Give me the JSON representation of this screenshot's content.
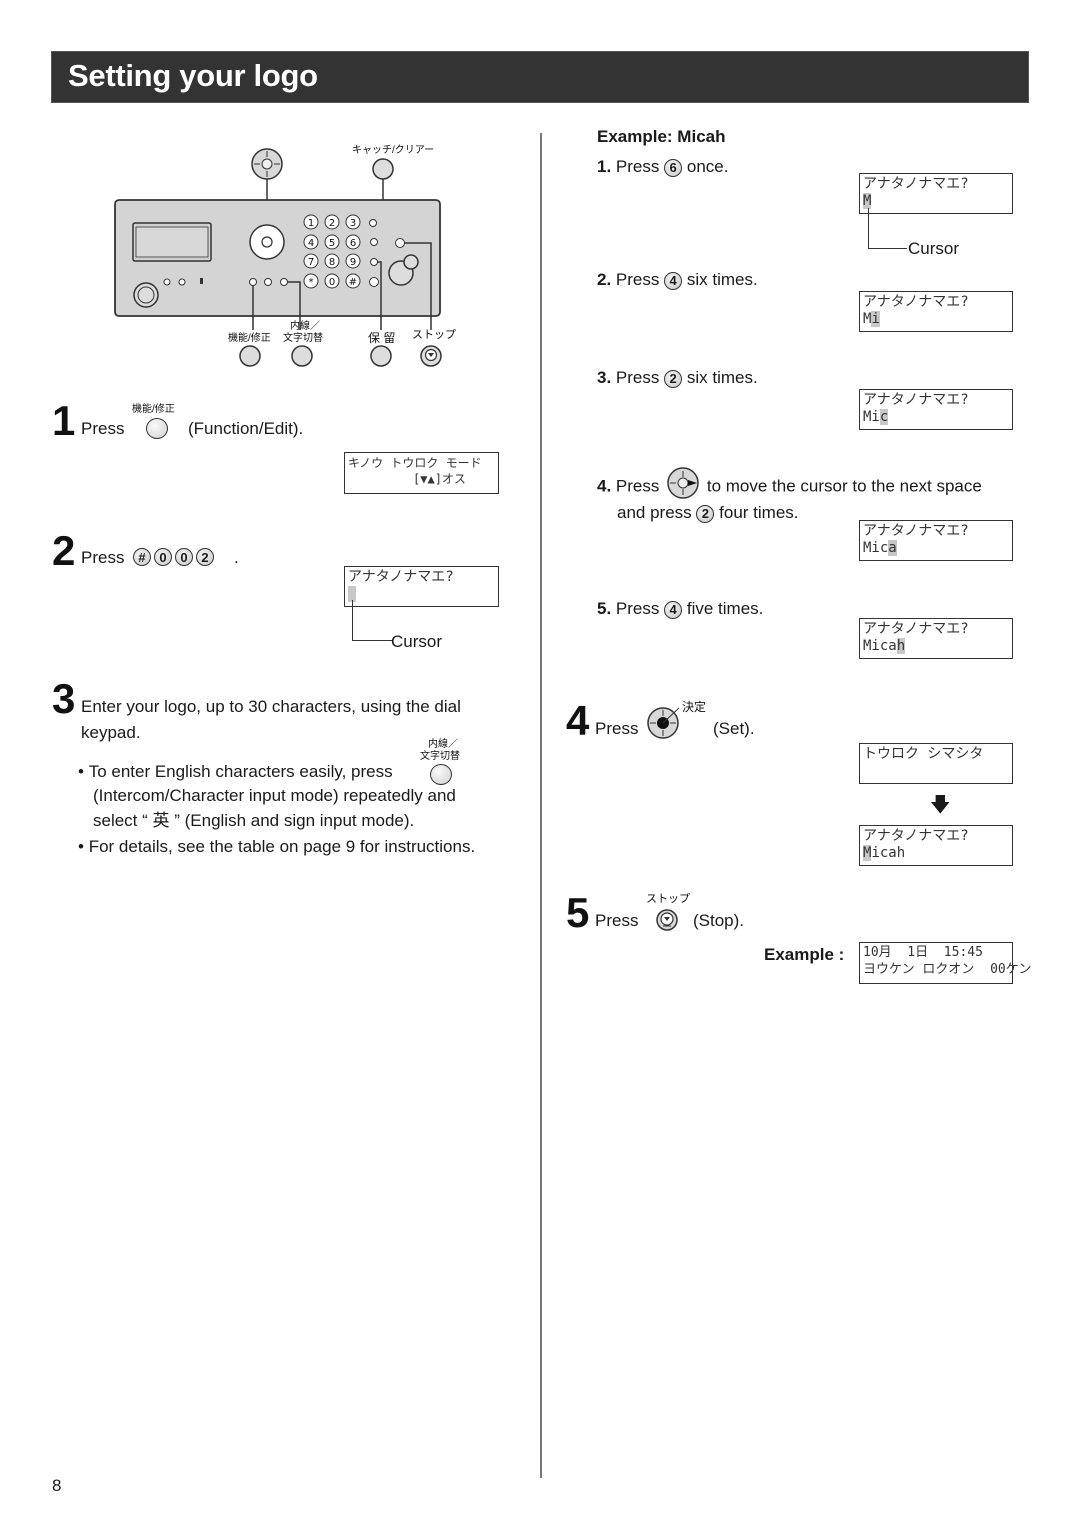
{
  "header": {
    "title": "Setting your logo"
  },
  "page_number": "8",
  "panel": {
    "labels": {
      "catch_clear": "キャッチ/クリアー",
      "function_edit": "機能/修正",
      "intercom_char": "内線／\n文字切替",
      "intercom_line1": "内線／",
      "intercom_line2": "文字切替",
      "hold": "保 留",
      "stop": "ストップ"
    },
    "keypad": [
      "1",
      "2",
      "3",
      "4",
      "5",
      "6",
      "7",
      "8",
      "9",
      "*",
      "0",
      "#"
    ]
  },
  "left": {
    "step1": {
      "num": "1",
      "press": "Press",
      "key_label": "機能/修正",
      "action": "(Function/Edit).",
      "lcd": [
        "キノウ トウロク モード",
        "         [▼▲]オス"
      ]
    },
    "step2": {
      "num": "2",
      "press": "Press",
      "keys": [
        "#",
        "0",
        "0",
        "2"
      ],
      "period": ".",
      "lcd_line1": "アナタノナマエ?",
      "cursor_label": "Cursor"
    },
    "step3": {
      "num": "3",
      "text_line1": "Enter your logo, up to 30 characters, using the dial",
      "text_line2": "keypad.",
      "bullet1_line1": "To enter English characters easily, press",
      "bullet1_key_line1": "内線／",
      "bullet1_key_line2": "文字切替",
      "bullet1_line2": "(Intercom/Character input mode) repeatedly and",
      "bullet1_line3": "select “ 英 ” (English and sign input mode).",
      "bullet2": "For details, see the table on page 9 for instructions."
    }
  },
  "right": {
    "example_title": "Example: Micah",
    "substeps": [
      {
        "num": "1.",
        "press": "Press",
        "key": "6",
        "text": "once.",
        "lcd_line1": "アナタノナマエ?",
        "typed": "",
        "cursor_char": "M"
      },
      {
        "num": "2.",
        "press": "Press",
        "key": "4",
        "text": "six times.",
        "lcd_line1": "アナタノナマエ?",
        "typed": "M",
        "cursor_char": "i"
      },
      {
        "num": "3.",
        "press": "Press",
        "key": "2",
        "text": "six times.",
        "lcd_line1": "アナタノナマエ?",
        "typed": "Mi",
        "cursor_char": "c"
      },
      {
        "num": "4.",
        "press": "Press",
        "text": "to move the cursor to the next space",
        "text2_pre": "and press",
        "key": "2",
        "text2_post": "four times.",
        "lcd_line1": "アナタノナマエ?",
        "typed": "Mic",
        "cursor_char": "a"
      },
      {
        "num": "5.",
        "press": "Press",
        "key": "4",
        "text": "five times.",
        "lcd_line1": "アナタノナマエ?",
        "typed": "Mica",
        "cursor_char": "h"
      }
    ],
    "cursor_label": "Cursor",
    "step4": {
      "num": "4",
      "press": "Press",
      "key_label": "決定",
      "action": "(Set).",
      "lcd_registered": "トウロク シマシタ",
      "lcd_final_line1": "アナタノナマエ?",
      "lcd_final_cursor": "M",
      "lcd_final_rest": "icah"
    },
    "step5": {
      "num": "5",
      "press": "Press",
      "key_label": "ストップ",
      "action": "(Stop).",
      "example_label": "Example :",
      "lcd_line1": "10月  1日  15:45",
      "lcd_line2": "ヨウケン ロクオン  00ケン"
    }
  }
}
